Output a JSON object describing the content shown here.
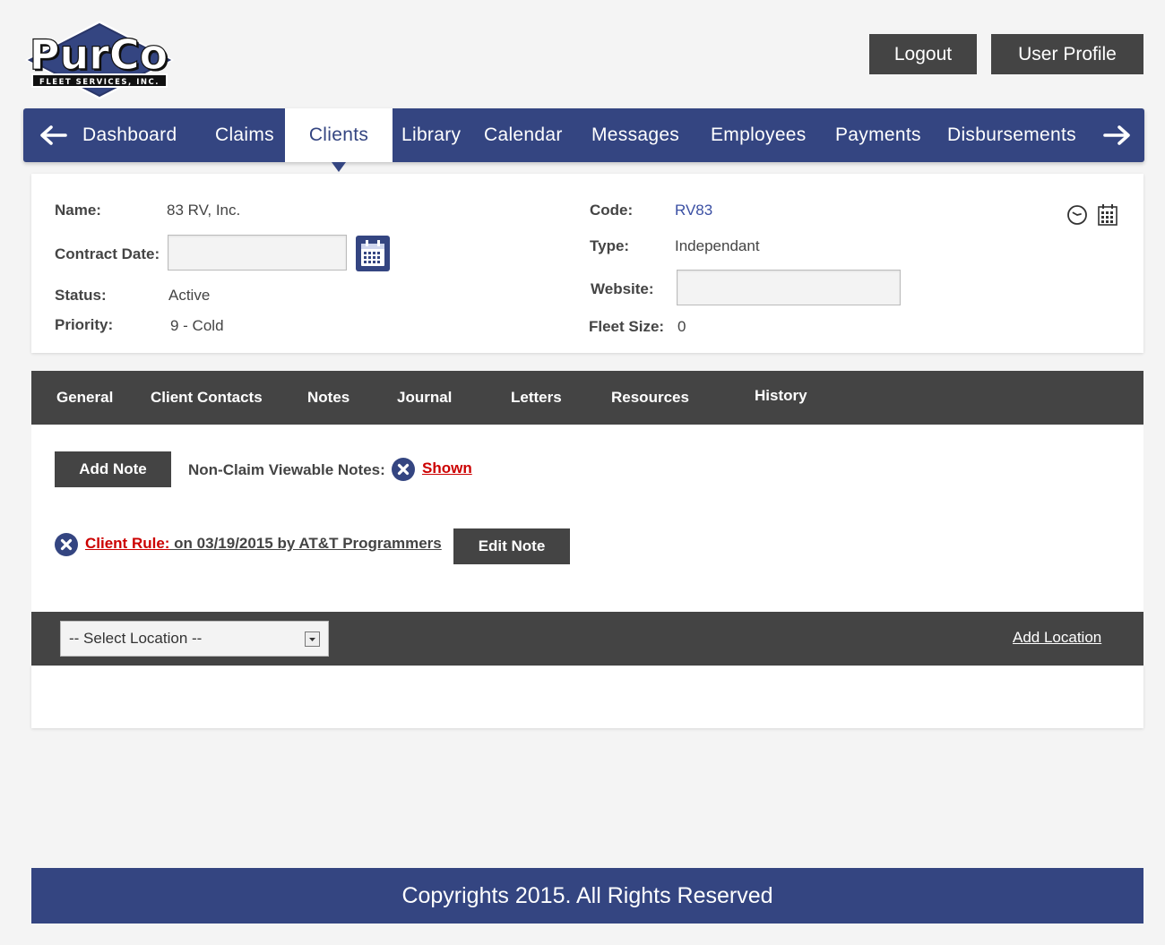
{
  "brand": {
    "logo_main": "PurCo",
    "logo_sub": "FLEET SERVICES, INC."
  },
  "header": {
    "logout_label": "Logout",
    "profile_label": "User Profile"
  },
  "nav": {
    "items": [
      {
        "label": "Dashboard"
      },
      {
        "label": "Claims"
      },
      {
        "label": "Clients",
        "active": true
      },
      {
        "label": "Library"
      },
      {
        "label": "Calendar"
      },
      {
        "label": "Messages"
      },
      {
        "label": "Employees"
      },
      {
        "label": "Payments"
      },
      {
        "label": "Disbursements"
      }
    ],
    "prev_icon": "arrow-left-icon",
    "next_icon": "arrow-right-icon"
  },
  "client": {
    "name_label": "Name:",
    "name": "83 RV, Inc.",
    "contract_label": "Contract Date:",
    "contract_value": "",
    "status_label": "Status:",
    "status": "Active",
    "priority_label": "Priority:",
    "priority": "9 - Cold",
    "code_label": "Code:",
    "code": "RV83",
    "type_label": "Type:",
    "type": "Independant",
    "website_label": "Website:",
    "website_value": "",
    "fleet_label": "Fleet Size:",
    "fleet": "0"
  },
  "tabs": {
    "items": [
      {
        "label": "General"
      },
      {
        "label": "Client Contacts"
      },
      {
        "label": "Notes",
        "active": true
      },
      {
        "label": "Journal"
      },
      {
        "label": "Letters"
      },
      {
        "label": "Resources"
      },
      {
        "label": "History"
      }
    ]
  },
  "notes": {
    "add_label": "Add Note",
    "viewable_label": "Non-Claim Viewable Notes:",
    "shown_label": "Shown",
    "rule_label": "Client Rule:",
    "rule_meta": " on 03/19/2015 by AT&T Programmers",
    "edit_label": "Edit Note"
  },
  "location": {
    "select_value": "-- Select Location --",
    "add_label": "Add Location"
  },
  "footer": {
    "text": "Copyrights 2015. All Rights Reserved"
  },
  "colors": {
    "brand_blue": "#344581",
    "dark_gray": "#444444",
    "alert_red": "#cc0000"
  }
}
